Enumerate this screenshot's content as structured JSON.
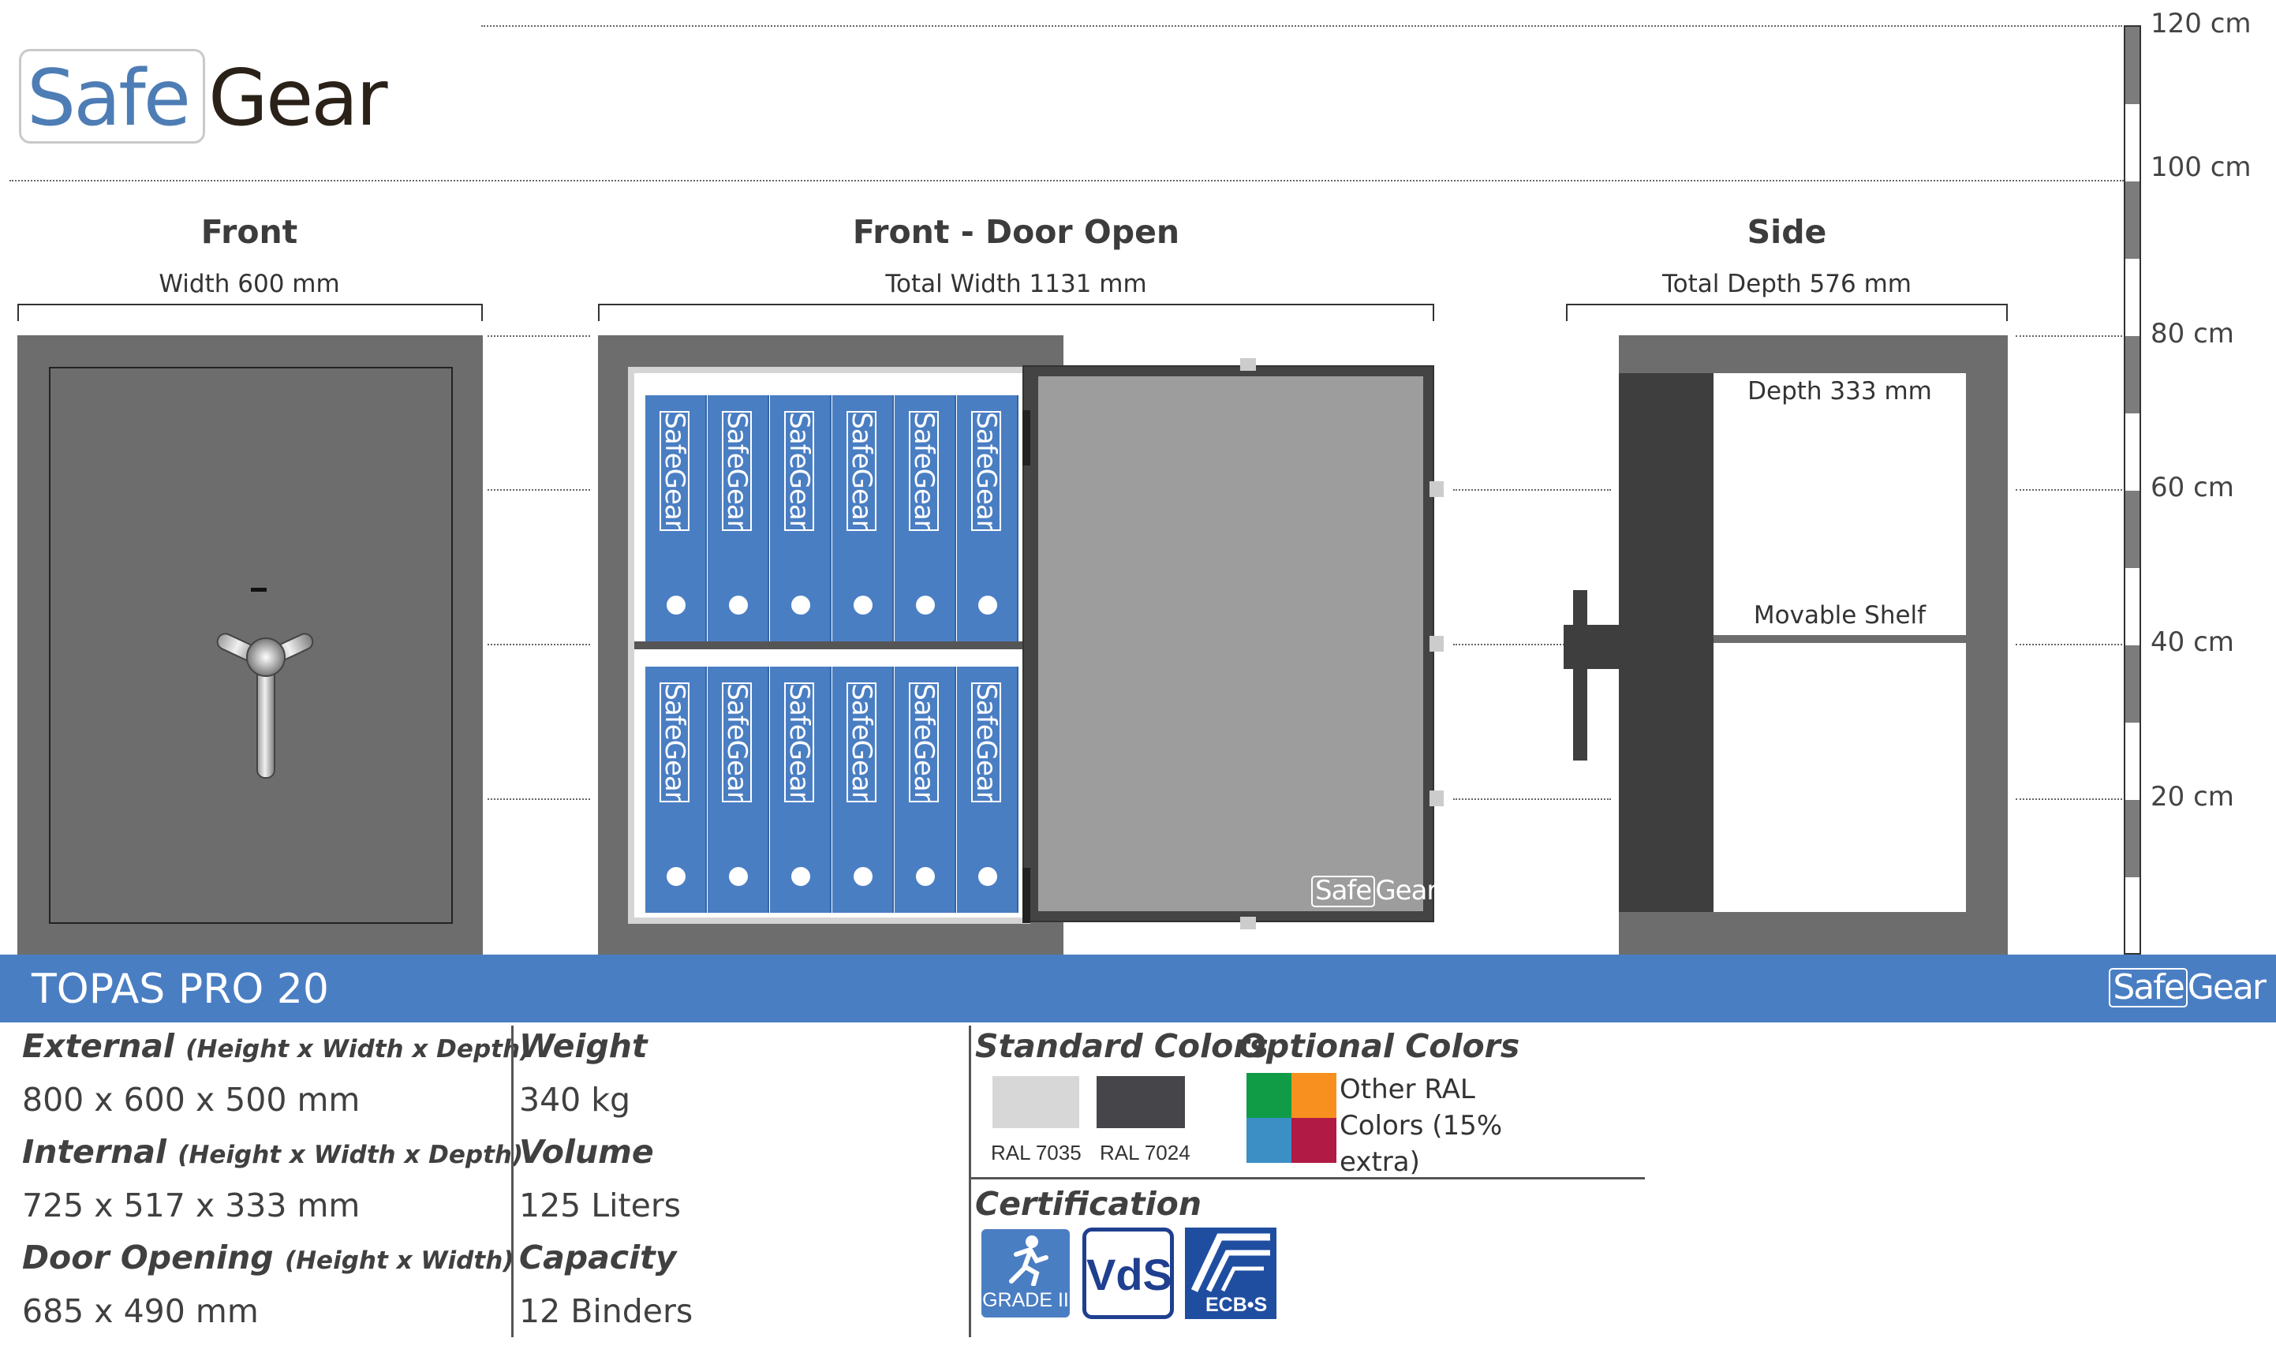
{
  "brand": {
    "part1": "Safe",
    "part2": "Gear"
  },
  "views": {
    "front": {
      "title": "Front",
      "dimension": "Width 600 mm"
    },
    "door_open": {
      "title": "Front - Door Open",
      "dimension": "Total Width 1131 mm",
      "binder_label": "SafeGear",
      "door_logo_part1": "Safe",
      "door_logo_part2": "Gear"
    },
    "side": {
      "title": "Side",
      "dimension": "Total Depth 576 mm",
      "depth_label": "Depth 333 mm",
      "shelf_label": "Movable Shelf"
    }
  },
  "scale": {
    "ticks": [
      "120 cm",
      "100 cm",
      "80 cm",
      "60 cm",
      "40 cm",
      "20 cm"
    ]
  },
  "product": {
    "name": "TOPAS PRO 20"
  },
  "specs": {
    "external_label": "External",
    "external_note": "(Height x Width x Depth)",
    "external_value": "800 x 600 x 500 mm",
    "internal_label": "Internal",
    "internal_note": "(Height x Width x Depth)",
    "internal_value": "725 x 517 x 333 mm",
    "door_label": "Door Opening",
    "door_note": "(Height x Width)",
    "door_value": "685 x 490 mm",
    "weight_label": "Weight",
    "weight_value": "340 kg",
    "volume_label": "Volume",
    "volume_value": "125 Liters",
    "capacity_label": "Capacity",
    "capacity_value": "12 Binders"
  },
  "colors": {
    "standard_title": "Standard Colors",
    "optional_title": "Optional Colors",
    "standard": [
      {
        "name": "RAL 7035",
        "hex": "#d7d7d7"
      },
      {
        "name": "RAL 7024",
        "hex": "#45454a"
      }
    ],
    "optional_text": "Other RAL Colors (15% extra)",
    "optional_swatches": [
      "#109c47",
      "#f7901e",
      "#3b8fc4",
      "#b01a44"
    ]
  },
  "certification": {
    "title": "Certification",
    "grade_label": "GRADE II",
    "vds_label": "VdS",
    "ecbs_label": "ECB•S"
  },
  "palette": {
    "blue": "#4a7ec3",
    "body_gray": "#6d6d6d",
    "dark_gray": "#444444"
  }
}
